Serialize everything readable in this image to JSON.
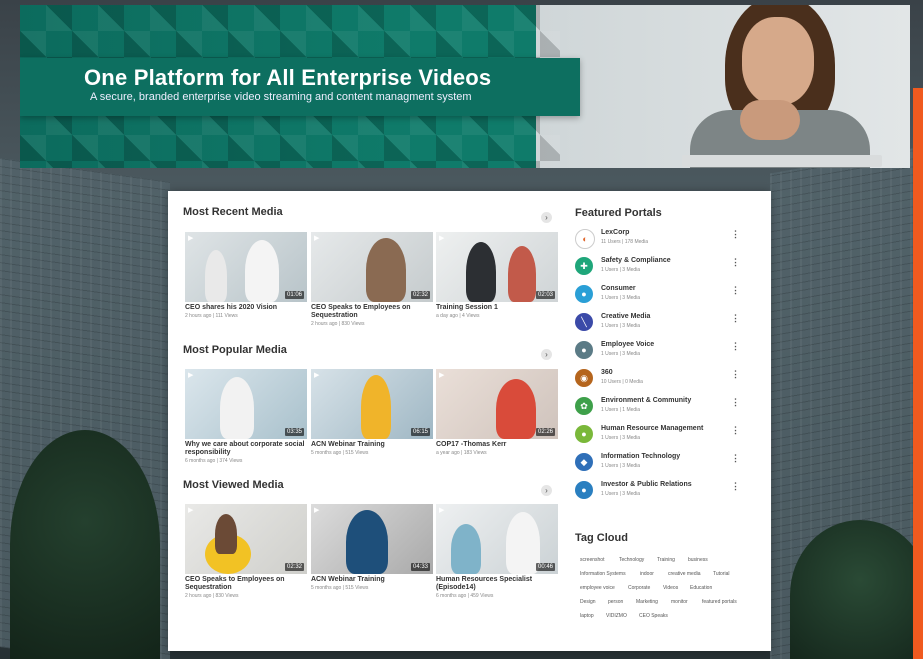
{
  "hero": {
    "title": "One Platform for All Enterprise Videos",
    "subtitle": "A secure, branded enterprise video streaming and content managment system"
  },
  "sections": {
    "recent": {
      "title": "Most Recent Media",
      "arrow": "›",
      "items": [
        {
          "title": "CEO shares his 2020 Vision",
          "meta": "2 hours ago | 111 Views",
          "duration": "01:06",
          "play": "▶"
        },
        {
          "title": "CEO Speaks to Employees on Sequestration",
          "meta": "2 hours ago | 830 Views",
          "duration": "02:32",
          "play": "▶"
        },
        {
          "title": "Training Session 1",
          "meta": "a day ago | 4 Views",
          "duration": "02:03",
          "play": "▶"
        }
      ]
    },
    "popular": {
      "title": "Most Popular Media",
      "arrow": "›",
      "items": [
        {
          "title": "Why we care about corporate social responsibility",
          "meta": "6 months ago | 374 Views",
          "duration": "03:35",
          "play": "▶"
        },
        {
          "title": "ACN Webinar Training",
          "meta": "5 months ago | 515 Views",
          "duration": "06:15",
          "play": "▶"
        },
        {
          "title": "COP17 -Thomas Kerr",
          "meta": "a year ago | 183 Views",
          "duration": "02:26",
          "play": "▶"
        }
      ]
    },
    "viewed": {
      "title": "Most Viewed Media",
      "arrow": "›",
      "items": [
        {
          "title": "CEO Speaks to Employees on Sequestration",
          "meta": "2 hours ago | 830 Views",
          "duration": "02:32",
          "play": "▶"
        },
        {
          "title": "ACN Webinar Training",
          "meta": "5 months ago | 515 Views",
          "duration": "04:33",
          "play": "▶"
        },
        {
          "title": "Human Resources Specialist (Episode14)",
          "meta": "6 months ago | 459 Views",
          "duration": "00:46",
          "play": "▶"
        }
      ]
    }
  },
  "featured": {
    "title": "Featured Portals",
    "more": "⋮",
    "items": [
      {
        "name": "LexCorp",
        "meta": "11 Users | 178 Media",
        "icon": "◐",
        "color": "#ffffff"
      },
      {
        "name": "Safety & Compliance",
        "meta": "1 Users | 3 Media",
        "icon": "✚",
        "color": "#1fa67a"
      },
      {
        "name": "Consumer",
        "meta": "1 Users | 3 Media",
        "icon": "●",
        "color": "#2a9fd6"
      },
      {
        "name": "Creative Media",
        "meta": "1 Users | 3 Media",
        "icon": "╲",
        "color": "#3b4aa8"
      },
      {
        "name": "Employee Voice",
        "meta": "1 Users | 3 Media",
        "icon": "●",
        "color": "#5b7b86"
      },
      {
        "name": "360",
        "meta": "10 Users | 0 Media",
        "icon": "◉",
        "color": "#b5651d"
      },
      {
        "name": "Environment & Community",
        "meta": "1 Users | 1 Media",
        "icon": "✿",
        "color": "#3ea04a"
      },
      {
        "name": "Human Resource Management",
        "meta": "1 Users | 3 Media",
        "icon": "●",
        "color": "#7ab83a"
      },
      {
        "name": "Information Technology",
        "meta": "1 Users | 3 Media",
        "icon": "◆",
        "color": "#2f6fb8"
      },
      {
        "name": "Investor & Public Relations",
        "meta": "1 Users | 3 Media",
        "icon": "●",
        "color": "#2a7fc0"
      }
    ]
  },
  "tagcloud": {
    "title": "Tag Cloud",
    "rows": [
      [
        "screenshot",
        "Technology",
        "Training",
        "business"
      ],
      [
        "Information Systems",
        "indoor",
        "creative media",
        "Tutorial"
      ],
      [
        "employee voice",
        "Corporate",
        "Videos",
        "Education"
      ],
      [
        "Design",
        "person",
        "Marketing",
        "monitor",
        "featured portals"
      ],
      [
        "laptop",
        "VIDIZMO",
        "CEO Speaks"
      ]
    ]
  }
}
